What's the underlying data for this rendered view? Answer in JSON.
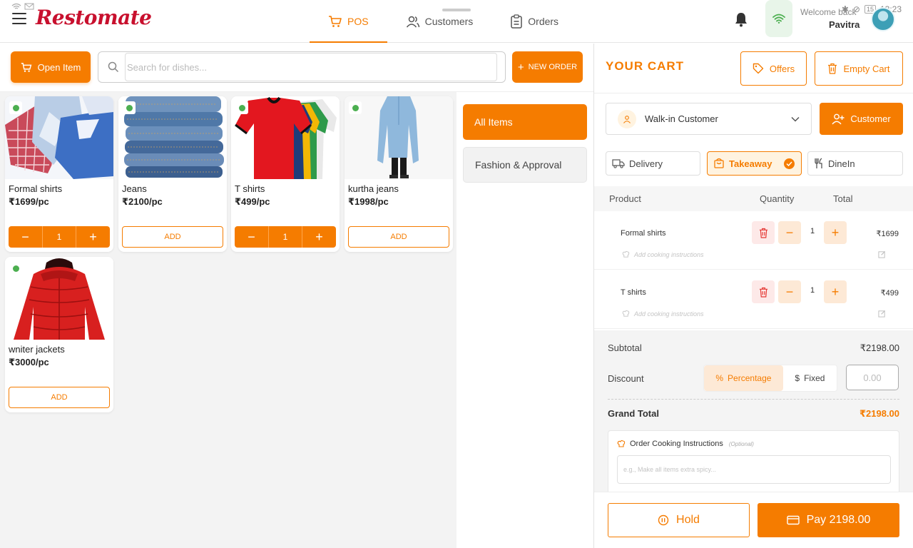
{
  "status_bar": {
    "left_icons": "wifi, mail",
    "time": "13:23",
    "battery": "15"
  },
  "app": {
    "logo_text": "Restomate"
  },
  "nav": [
    {
      "label": "POS",
      "active": true
    },
    {
      "label": "Customers",
      "active": false
    },
    {
      "label": "Orders",
      "active": false
    }
  ],
  "user": {
    "welcome": "Welcome back",
    "name": "Pavitra"
  },
  "toolbar": {
    "open_item_label": "Open Item",
    "search_placeholder": "Search for dishes...",
    "new_order_label": "NEW ORDER"
  },
  "products": [
    {
      "name": "Formal shirts",
      "price": "₹1699/pc",
      "in_cart": true,
      "qty": "1",
      "image": "shirts"
    },
    {
      "name": "Jeans",
      "price": "₹2100/pc",
      "in_cart": false,
      "add_label": "ADD",
      "image": "jeans"
    },
    {
      "name": "T shirts",
      "price": "₹499/pc",
      "in_cart": true,
      "qty": "1",
      "image": "tshirts"
    },
    {
      "name": "kurtha jeans",
      "price": "₹1998/pc",
      "in_cart": false,
      "add_label": "ADD",
      "image": "kurtha"
    },
    {
      "name": "wniter jackets",
      "price": "₹3000/pc",
      "in_cart": false,
      "add_label": "ADD",
      "image": "jacket"
    }
  ],
  "categories": [
    {
      "label": "All Items",
      "active": true
    },
    {
      "label": "Fashion & Approval",
      "active": false
    }
  ],
  "cart": {
    "title": "YOUR CART",
    "offers_label": "Offers",
    "empty_label": "Empty Cart",
    "customer_select": "Walk-in Customer",
    "customer_button": "Customer",
    "order_types": [
      {
        "label": "Delivery",
        "selected": false
      },
      {
        "label": "Takeaway",
        "selected": true
      },
      {
        "label": "DineIn",
        "selected": false
      }
    ],
    "columns": {
      "product": "Product",
      "quantity": "Quantity",
      "total": "Total"
    },
    "items": [
      {
        "name": "Formal shirts",
        "qty": "1",
        "total": "₹1699",
        "cook_placeholder": "Add cooking instructions"
      },
      {
        "name": "T shirts",
        "qty": "1",
        "total": "₹499",
        "cook_placeholder": "Add cooking instructions"
      }
    ],
    "subtotal_label": "Subtotal",
    "subtotal_value": "₹2198.00",
    "discount_label": "Discount",
    "discount_percentage": "Percentage",
    "discount_fixed": "Fixed",
    "discount_placeholder": "0.00",
    "grand_total_label": "Grand Total",
    "grand_total_value": "₹2198.00",
    "instructions_title": "Order Cooking Instructions",
    "instructions_optional": "(Optional)",
    "instructions_placeholder": "e.g., Make all items extra spicy...",
    "hold_label": "Hold",
    "pay_label": "Pay 2198.00"
  },
  "colors": {
    "accent": "#f57c00",
    "brand_red": "#c8102e",
    "veg_green": "#4caf50"
  }
}
